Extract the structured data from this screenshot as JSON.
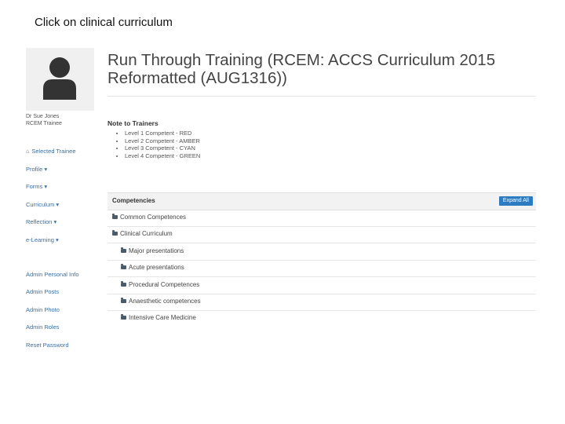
{
  "caption": "Click on clinical curriculum",
  "sidebar": {
    "user_name": "Dr Sue Jones",
    "user_role": "RCEM Trainee",
    "links": [
      {
        "label": "Selected Trainee",
        "icon": "home-icon"
      },
      {
        "label": "Profile"
      },
      {
        "label": "Forms"
      },
      {
        "label": "Curriculum"
      },
      {
        "label": "Reflection"
      },
      {
        "label": "e-Learning"
      },
      {
        "label": "Admin Personal Info"
      },
      {
        "label": "Admin Posts"
      },
      {
        "label": "Admin Photo"
      },
      {
        "label": "Admin Roles"
      },
      {
        "label": "Reset Password"
      }
    ]
  },
  "main": {
    "title": "Run Through Training (RCEM: ACCS Curriculum 2015 Reformatted (AUG1316))",
    "notes_heading": "Note to Trainers",
    "notes": [
      "Level 1 Competent - RED",
      "Level 2 Competent - AMBER",
      "Level 3 Competent - CYAN",
      "Level 4 Competent - GREEN"
    ],
    "competencies": {
      "heading": "Competencies",
      "expand_label": "Expand All",
      "items": [
        {
          "label": "Common Competences"
        },
        {
          "label": "Clinical Curriculum"
        },
        {
          "label": "Major presentations"
        },
        {
          "label": "Acute presentations"
        },
        {
          "label": "Procedural Competences"
        },
        {
          "label": "Anaesthetic competences"
        },
        {
          "label": "Intensive Care Medicine"
        }
      ]
    }
  },
  "colors": {
    "accent": "#2d7cc1",
    "link": "#3a6fa5",
    "folder": "#4a5b6a"
  }
}
